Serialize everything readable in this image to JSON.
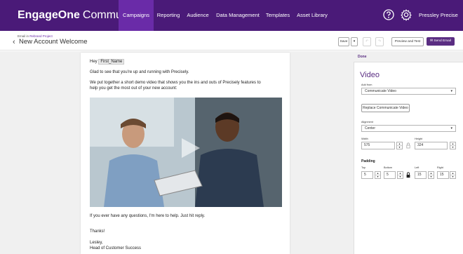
{
  "nav": {
    "brand_bold": "EngageOne",
    "brand_light": "Communicate",
    "tabs": [
      {
        "label": "Campaigns",
        "active": true
      },
      {
        "label": "Reporting",
        "active": false
      },
      {
        "label": "Audience",
        "active": false
      },
      {
        "label": "Data Management",
        "active": false
      },
      {
        "label": "Templates",
        "active": false
      },
      {
        "label": "Asset Library",
        "active": false
      }
    ],
    "icons": [
      "help-icon",
      "gear-icon"
    ],
    "user_name": "Pressley Precise"
  },
  "subheader": {
    "crumb_prefix": "Email in",
    "crumb_project": "Rebrand Project",
    "title": "New Account Welcome",
    "toolbar": {
      "save_label": "Save",
      "preview_label": "Preview and Test",
      "send_label": "Send Email"
    }
  },
  "email": {
    "greeting_prefix": "Hey",
    "token": "First_Name",
    "line1": "Glad to see that you're up and running with Precisely.",
    "line2a": "We put together a short demo video that shows you the ins and outs of Precisely features to",
    "line2b": "help you get the most out of your new account:",
    "line3": "If you ever have any questions, I'm here to help. Just hit reply.",
    "thanks": "Thanks!",
    "sign1": "Lesley,",
    "sign2": "Head of Customer Success"
  },
  "panel": {
    "done_label": "Done",
    "title": "Video",
    "add_from_label": "Add from",
    "add_from_value": "Communicate Video",
    "replace_label": "Replace Communicate Video",
    "alignment_label": "Alignment",
    "alignment_value": "Center",
    "width_label": "Width",
    "width_value": "575",
    "height_label": "Height",
    "height_value": "324",
    "padding_label": "Padding",
    "top_label": "Top",
    "top_value": "5",
    "bottom_label": "Bottom",
    "bottom_value": "5",
    "left_label": "Left",
    "left_value": "15",
    "right_label": "Right",
    "right_value": "15"
  },
  "colors": {
    "nav_bg": "#4a1a78",
    "nav_active": "#6a2ba8",
    "accent": "#5a2d82"
  }
}
